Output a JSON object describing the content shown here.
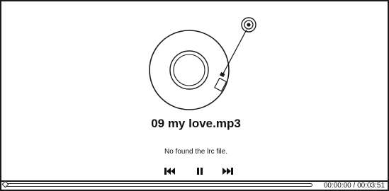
{
  "player": {
    "track_title": "09 my love.mp3",
    "lyrics_status": "No found the lrc file.",
    "turntable_icon": "vinyl-record-icon",
    "controls": {
      "previous_icon": "previous-track-icon",
      "pause_icon": "pause-icon",
      "next_icon": "next-track-icon"
    },
    "progress": {
      "fraction": 0,
      "current_time": "00:00:00",
      "total_time": "00:03:51",
      "readout": "00:00:00 / 00:03:51"
    },
    "colors": {
      "ink": "#1a1a1a",
      "background": "#ffffff"
    }
  }
}
